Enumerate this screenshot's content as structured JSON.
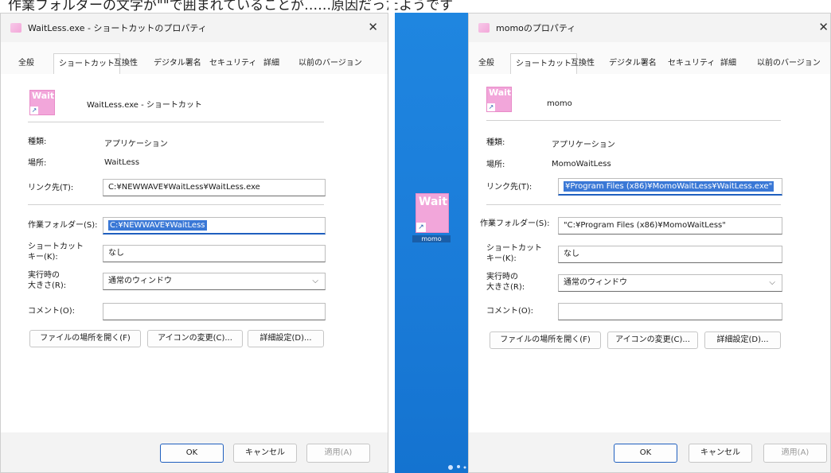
{
  "caption": "作業フォルダーの文字が\"\"で囲まれていることが……原因だったようです",
  "left": {
    "title": "WaitLess.exe - ショートカットのプロパティ",
    "close": "✕",
    "tabs": [
      "全般",
      "ショートカット",
      "互換性",
      "デジタル署名",
      "セキュリティ",
      "詳細",
      "以前のバージョン"
    ],
    "active_tab": "ショートカット",
    "icon_text": "Wait",
    "name": "WaitLess.exe - ショートカット",
    "type_label": "種類:",
    "type_value": "アプリケーション",
    "loc_label": "場所:",
    "loc_value": "WaitLess",
    "target_label": "リンク先(T):",
    "target_value": "C:¥NEWWAVE¥WaitLess¥WaitLess.exe",
    "workdir_label": "作業フォルダー(S):",
    "workdir_value": "C:¥NEWWAVE¥WaitLess",
    "hotkey_label": "ショートカット\nキー(K):",
    "hotkey_value": "なし",
    "run_label": "実行時の\n大きさ(R):",
    "run_value": "通常のウィンドウ",
    "comment_label": "コメント(O):",
    "comment_value": "",
    "btn_open": "ファイルの場所を開く(F)",
    "btn_icon": "アイコンの変更(C)...",
    "btn_adv": "詳細設定(D)...",
    "ok": "OK",
    "cancel": "キャンセル",
    "apply": "適用(A)"
  },
  "right": {
    "title": "momoのプロパティ",
    "close": "✕",
    "tabs": [
      "全般",
      "ショートカット",
      "互換性",
      "デジタル署名",
      "セキュリティ",
      "詳細",
      "以前のバージョン"
    ],
    "active_tab": "ショートカット",
    "icon_text": "Wait",
    "name": "momo",
    "type_label": "種類:",
    "type_value": "アプリケーション",
    "loc_label": "場所:",
    "loc_value": "MomoWaitLess",
    "target_label": "リンク先(T):",
    "target_value": "¥Program Files (x86)¥MomoWaitLess¥WaitLess.exe\"",
    "workdir_label": "作業フォルダー(S):",
    "workdir_value": "\"C:¥Program Files (x86)¥MomoWaitLess\"",
    "hotkey_label": "ショートカット\nキー(K):",
    "hotkey_value": "なし",
    "run_label": "実行時の\n大きさ(R):",
    "run_value": "通常のウィンドウ",
    "comment_label": "コメント(O):",
    "comment_value": "",
    "btn_open": "ファイルの場所を開く(F)",
    "btn_icon": "アイコンの変更(C)...",
    "btn_adv": "詳細設定(D)...",
    "ok": "OK",
    "cancel": "キャンセル",
    "apply": "適用(A)"
  },
  "desktop": {
    "icon_text": "Wait",
    "label": "momo",
    "background": "#1a7bd8"
  }
}
